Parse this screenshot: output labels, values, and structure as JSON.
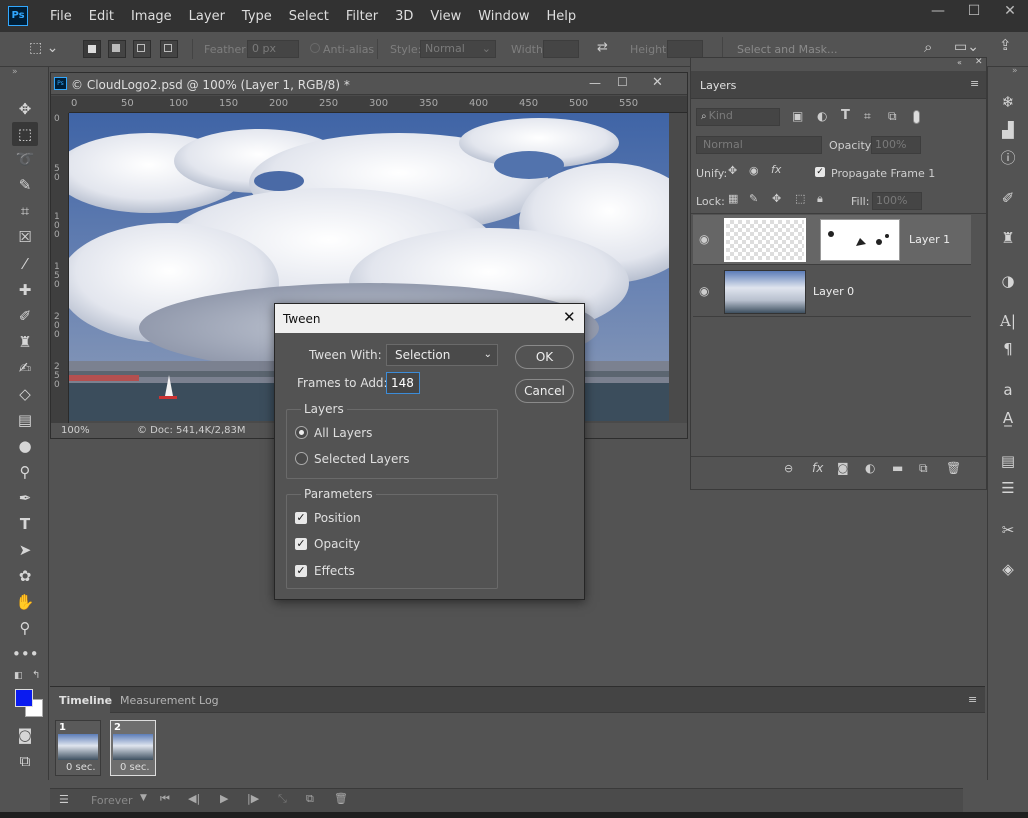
{
  "app": {
    "logo": "Ps"
  },
  "menu": [
    "File",
    "Edit",
    "Image",
    "Layer",
    "Type",
    "Select",
    "Filter",
    "3D",
    "View",
    "Window",
    "Help"
  ],
  "window_controls": {
    "minimize": "—",
    "maximize": "☐",
    "close": "✕"
  },
  "options": {
    "feather_label": "Feather:",
    "feather_value": "0 px",
    "antialias_label": "Anti-alias",
    "style_label": "Style:",
    "style_value": "Normal",
    "width_label": "Width:",
    "height_label": "Height:",
    "select_mask": "Select and Mask..."
  },
  "document": {
    "title": "© CloudLogo2.psd @ 100% (Layer 1, RGB/8) *",
    "zoom": "100%",
    "doc_info": "© Doc: 541,4K/2,83M",
    "ruler_h": [
      "0",
      "50",
      "100",
      "150",
      "200",
      "250",
      "300",
      "350",
      "400",
      "450",
      "500",
      "550"
    ],
    "ruler_v": [
      "0",
      "5 0",
      "1 0 0",
      "1 5 0",
      "2 0 0",
      "2 5 0"
    ]
  },
  "layers": {
    "tab": "Layers",
    "kind": "Kind",
    "blend": "Normal",
    "opacity_label": "Opacity:",
    "opacity_value": "100%",
    "unify_label": "Unify:",
    "propagate": "Propagate Frame 1",
    "lock_label": "Lock:",
    "fill_label": "Fill:",
    "fill_value": "100%",
    "items": [
      {
        "name": "Layer 1"
      },
      {
        "name": "Layer 0"
      }
    ]
  },
  "dialog": {
    "title": "Tween",
    "tween_with_label": "Tween With:",
    "tween_with_value": "Selection",
    "frames_label": "Frames to Add:",
    "frames_value": "148",
    "ok": "OK",
    "cancel": "Cancel",
    "layers_group": "Layers",
    "all_layers": "All Layers",
    "selected_layers": "Selected Layers",
    "params_group": "Parameters",
    "position": "Position",
    "opacity": "Opacity",
    "effects": "Effects"
  },
  "timeline": {
    "tabs": [
      "Timeline",
      "Measurement Log"
    ],
    "frames": [
      {
        "num": "1",
        "delay": "0 sec."
      },
      {
        "num": "2",
        "delay": "0 sec."
      }
    ],
    "loop": "Forever"
  },
  "colors": {
    "foreground": "#0a1bf0",
    "background": "#ffffff"
  }
}
